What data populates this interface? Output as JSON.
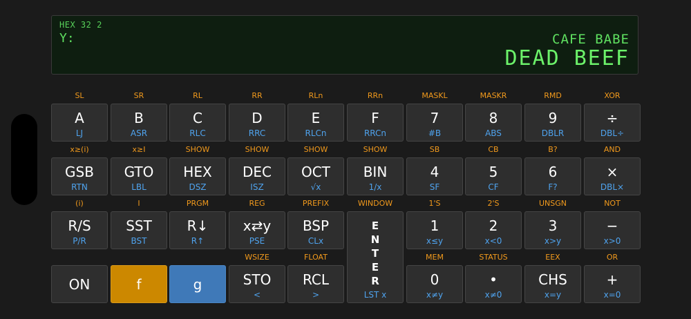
{
  "display": {
    "status": "HEX  32  2",
    "y_label": "Y:",
    "x_value": "CAFE BABE",
    "main_value": "DEAD BEEF"
  },
  "rows": [
    {
      "keys": [
        {
          "f": "SL",
          "main": "A",
          "g": "LJ"
        },
        {
          "f": "SR",
          "main": "B",
          "g": "ASR"
        },
        {
          "f": "RL",
          "main": "C",
          "g": "RLC"
        },
        {
          "f": "RR",
          "main": "D",
          "g": "RRC"
        },
        {
          "f": "RLn",
          "main": "E",
          "g": "RLCn"
        },
        {
          "f": "RRn",
          "main": "F",
          "g": "RRCn"
        },
        {
          "f": "MASKL",
          "main": "7",
          "g": "#B"
        },
        {
          "f": "MASKR",
          "main": "8",
          "g": "ABS"
        },
        {
          "f": "RMD",
          "main": "9",
          "g": "DBLR"
        },
        {
          "f": "XOR",
          "main": "÷",
          "g": "DBL÷"
        }
      ]
    },
    {
      "keys": [
        {
          "f": "x≥(i)",
          "main": "GSB",
          "g": "RTN"
        },
        {
          "f": "x≥I",
          "main": "GTO",
          "g": "LBL"
        },
        {
          "f": "SHOW",
          "main": "HEX",
          "g": "DSZ"
        },
        {
          "f": "SHOW",
          "main": "DEC",
          "g": "ISZ"
        },
        {
          "f": "SHOW",
          "main": "OCT",
          "g": "√x"
        },
        {
          "f": "SHOW",
          "main": "BIN",
          "g": "1/x"
        },
        {
          "f": "SB",
          "main": "4",
          "g": "SF"
        },
        {
          "f": "CB",
          "main": "5",
          "g": "CF"
        },
        {
          "f": "B?",
          "main": "6",
          "g": "F?"
        },
        {
          "f": "AND",
          "main": "×",
          "g": "DBL×"
        }
      ]
    },
    {
      "keys": [
        {
          "f": "(i)",
          "main": "R/S",
          "g": "P/R"
        },
        {
          "f": "I",
          "main": "SST",
          "g": "BST"
        },
        {
          "f": "PRGM",
          "main": "R↓",
          "g": "R↑"
        },
        {
          "f": "REG",
          "main": "x⇄y",
          "g": "PSE"
        },
        {
          "f": "PREFIX",
          "main": "BSP",
          "g": "CLx"
        },
        {
          "f": "WINDOW",
          "main": "ENTER",
          "g": "LST x"
        },
        {
          "f": "1'S",
          "main": "1",
          "g": "x≤y"
        },
        {
          "f": "2'S",
          "main": "2",
          "g": "x<0"
        },
        {
          "f": "UNSGN",
          "main": "3",
          "g": "x>y"
        },
        {
          "f": "NOT",
          "main": "−",
          "g": "x>0"
        }
      ]
    },
    {
      "keys": [
        {
          "f": "",
          "main": "ON",
          "g": ""
        },
        {
          "f": "",
          "main": "f",
          "g": ""
        },
        {
          "f": "",
          "main": "g",
          "g": ""
        },
        {
          "f": "WSIZE",
          "main": "STO",
          "g": "<"
        },
        {
          "f": "FLOAT",
          "main": "RCL",
          "g": ">"
        },
        {
          "f": "",
          "main": "",
          "g": ""
        },
        {
          "f": "MEM",
          "main": "0",
          "g": "x≠y"
        },
        {
          "f": "STATUS",
          "main": "•",
          "g": "x≠0"
        },
        {
          "f": "EEX",
          "main": "CHS",
          "g": "x=y"
        },
        {
          "f": "OR",
          "main": "+",
          "g": "x=0"
        }
      ]
    }
  ],
  "enter_letters": [
    "E",
    "N",
    "T",
    "E",
    "R"
  ],
  "colors": {
    "f_shift": "#cc8800",
    "g_shift": "#3f79b8",
    "f_label": "#f29a1c",
    "g_label": "#4fa3ee",
    "lcd_text": "#6cf26a"
  }
}
